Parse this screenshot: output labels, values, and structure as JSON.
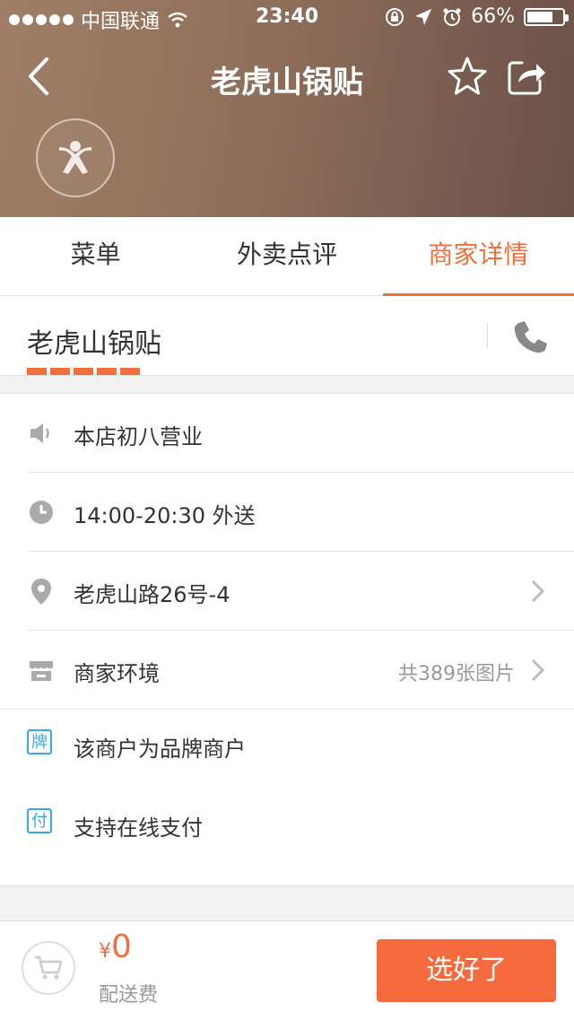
{
  "status_bar": {
    "carrier": "中国联通",
    "time": "23:40",
    "battery": "66%"
  },
  "nav": {
    "title": "老虎山锅贴",
    "back_icon": "back-arrow-icon",
    "favorite_icon": "star-icon",
    "share_icon": "share-icon"
  },
  "tabs": [
    {
      "label": "菜单",
      "active": false
    },
    {
      "label": "外卖点评",
      "active": false
    },
    {
      "label": "商家详情",
      "active": true
    }
  ],
  "shop": {
    "name": "老虎山锅贴"
  },
  "info_rows": [
    {
      "icon": "speaker-icon",
      "text": "本店初八营业"
    },
    {
      "icon": "clock-icon",
      "text": "14:00-20:30 外送"
    },
    {
      "icon": "location-pin-icon",
      "text": "老虎山路26号-4"
    },
    {
      "icon": "store-icon",
      "text": "商家环境",
      "right": "共389张图片"
    }
  ],
  "badges": [
    {
      "badge": "牌",
      "text": "该商户为品牌商户"
    },
    {
      "badge": "付",
      "text": "支持在线支付"
    }
  ],
  "bottom": {
    "currency": "¥",
    "amount": "0",
    "fee_label": "配送费",
    "confirm_label": "选好了"
  },
  "colors": {
    "accent": "#f0703c",
    "badge_blue": "#36a9e1"
  }
}
